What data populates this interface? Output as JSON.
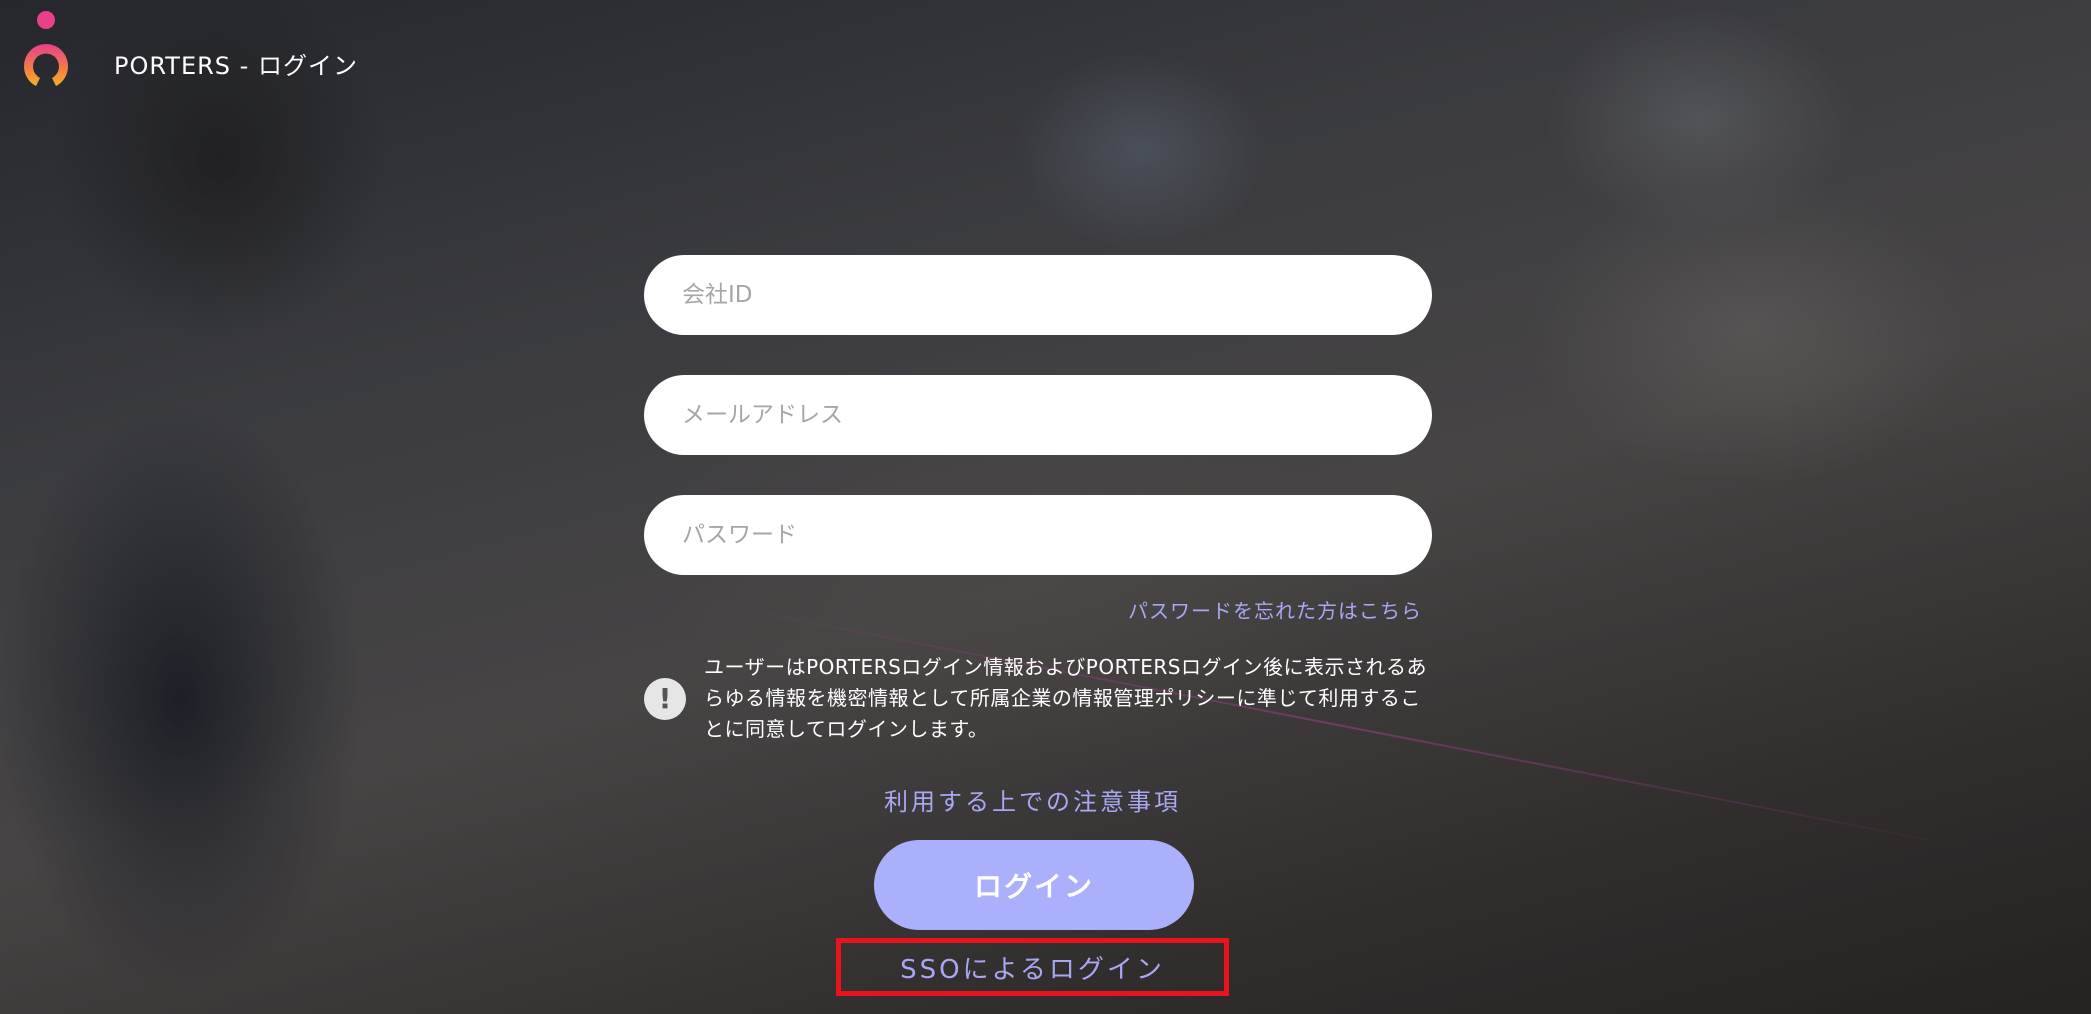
{
  "header": {
    "title": "PORTERS - ログイン",
    "logo_icon": "porters-logo"
  },
  "form": {
    "company_id": {
      "placeholder": "会社ID",
      "value": ""
    },
    "email": {
      "placeholder": "メールアドレス",
      "value": ""
    },
    "password": {
      "placeholder": "パスワード",
      "value": ""
    },
    "forgot_password": "パスワードを忘れた方はこちら"
  },
  "notice": {
    "icon": "exclamation-icon",
    "text": "ユーザーはPORTERSログイン情報およびPORTERSログイン後に表示されるあらゆる情報を機密情報として所属企業の情報管理ポリシーに準じて利用することに同意してログインします。"
  },
  "terms_link": "利用する上での注意事項",
  "login_button": "ログイン",
  "sso_link": "SSOによるログイン",
  "colors": {
    "accent": "#aab0fb",
    "link": "#a9a7f3",
    "highlight_frame": "#e8131c",
    "logo_pink": "#e8408a",
    "logo_orange": "#f5a623"
  }
}
